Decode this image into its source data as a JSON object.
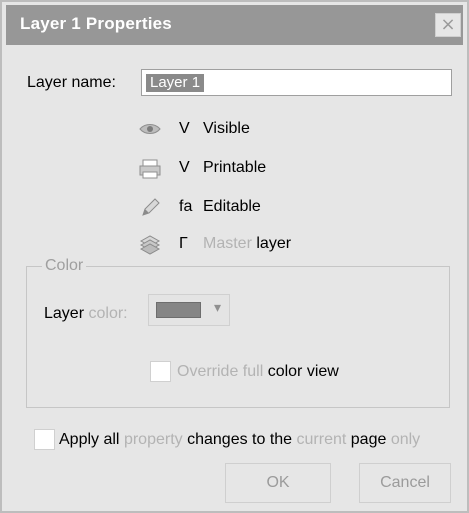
{
  "dialog": {
    "title": "Layer 1 Properties",
    "close_symbol": "×"
  },
  "layer_name": {
    "label": "Layer name:",
    "value": "Layer 1"
  },
  "options": [
    {
      "icon": "eye-icon",
      "mark": "V",
      "label": "Visible"
    },
    {
      "icon": "printer-icon",
      "mark": "V",
      "label": "Printable"
    },
    {
      "icon": "pencil-icon",
      "mark": "fa",
      "label": "Editable"
    },
    {
      "icon": "layers-icon",
      "mark": "Γ",
      "label_muted": "Master",
      "label_normal": "layer"
    }
  ],
  "color_group": {
    "title": "Color",
    "layer_color_label_left": "Layer",
    "layer_color_label_right": "color:",
    "selected_color": "#858585",
    "override_label_muted": "Override full",
    "override_label_normal": "color view"
  },
  "apply_all": {
    "part1": "Apply all",
    "part2": "property",
    "part3": "changes to the",
    "part4": "current",
    "part5": "page",
    "part6": "only"
  },
  "buttons": {
    "ok": "OK",
    "cancel": "Cancel"
  }
}
